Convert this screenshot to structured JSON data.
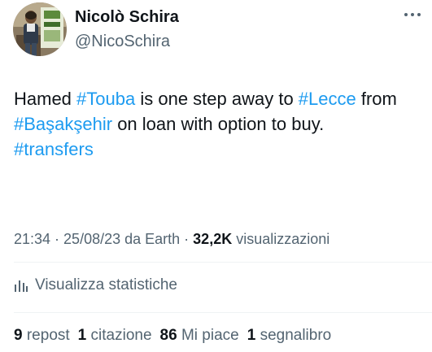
{
  "author": {
    "display_name": "Nicolò Schira",
    "handle": "@NicoSchira"
  },
  "tweet": {
    "segments": [
      {
        "text": "Hamed ",
        "type": "text"
      },
      {
        "text": "#Touba",
        "type": "hashtag"
      },
      {
        "text": " is one step away to ",
        "type": "text"
      },
      {
        "text": "#Lecce",
        "type": "hashtag"
      },
      {
        "text": " from ",
        "type": "text"
      },
      {
        "text": "#Başakşehir",
        "type": "hashtag"
      },
      {
        "text": " on loan with option to buy. ",
        "type": "text"
      },
      {
        "text": "#transfers",
        "type": "hashtag"
      }
    ]
  },
  "meta": {
    "time": "21:34",
    "separator1": " · ",
    "date": "25/08/23",
    "source": " da Earth",
    "separator2": " · ",
    "views_count": "32,2K",
    "views_label": " visualizzazioni"
  },
  "stats": {
    "label": "Visualizza statistiche"
  },
  "engagement": {
    "reposts_count": "9",
    "reposts_label": "repost",
    "quotes_count": "1",
    "quotes_label": "citazione",
    "likes_count": "86",
    "likes_label": "Mi piace",
    "bookmarks_count": "1",
    "bookmarks_label": "segnalibro"
  },
  "colors": {
    "hashtag": "#1d9bf0",
    "secondary_text": "#536471",
    "primary_text": "#0f1419"
  },
  "icons": {
    "more": "more-dots-icon",
    "stats": "bar-chart-icon"
  }
}
